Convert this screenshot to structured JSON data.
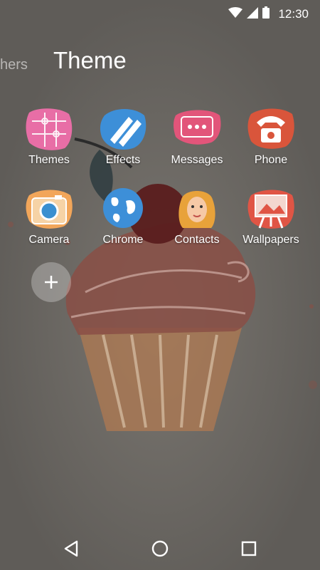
{
  "status_bar": {
    "time": "12:30",
    "icons": [
      "wifi-icon",
      "cell-signal-icon",
      "battery-icon"
    ]
  },
  "folder": {
    "prev_title_fragment": "hers",
    "title": "Theme",
    "apps": [
      {
        "label": "Themes",
        "icon": "puzzle-icon"
      },
      {
        "label": "Effects",
        "icon": "pencils-icon"
      },
      {
        "label": "Messages",
        "icon": "chat-bubble-icon"
      },
      {
        "label": "Phone",
        "icon": "telephone-icon"
      },
      {
        "label": "Camera",
        "icon": "camera-icon"
      },
      {
        "label": "Chrome",
        "icon": "globe-icon"
      },
      {
        "label": "Contacts",
        "icon": "face-portrait-icon"
      },
      {
        "label": "Wallpapers",
        "icon": "easel-icon"
      }
    ],
    "add_button_glyph": "+"
  },
  "nav": {
    "buttons": [
      "back-icon",
      "home-icon",
      "recents-icon"
    ]
  },
  "colors": {
    "background": "#6e6b66",
    "cupcake": "#8a4f45",
    "cherry": "#5a1e1e",
    "wrapper": "#c89868"
  }
}
